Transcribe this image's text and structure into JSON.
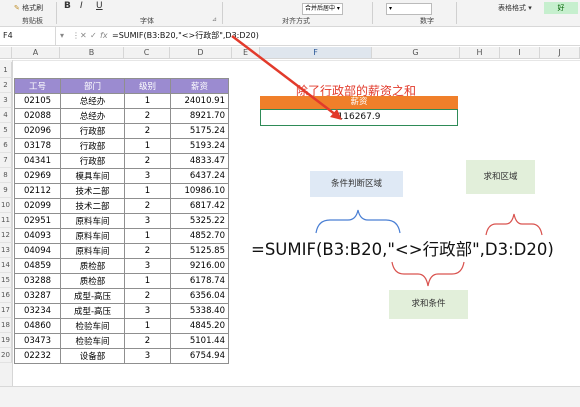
{
  "ribbon": {
    "format_painter": "格式刷",
    "groups": [
      "剪贴板",
      "字体",
      "对齐方式",
      "数字"
    ],
    "merge_label": "合并后居中",
    "table_style_label": "表格格式",
    "good_label": "好",
    "bold": "B",
    "italic": "I",
    "underline": "U"
  },
  "formula_bar": {
    "name_box": "F4",
    "fx": "fx",
    "formula": "=SUMIF(B3:B20,\"<>行政部\",D3:D20)"
  },
  "columns": [
    "A",
    "B",
    "C",
    "D",
    "E",
    "F",
    "G",
    "H",
    "I",
    "J"
  ],
  "rows": [
    "1",
    "2",
    "3",
    "4",
    "5",
    "6",
    "7",
    "8",
    "9",
    "10",
    "11",
    "12",
    "13",
    "14",
    "15",
    "16",
    "17",
    "18",
    "19",
    "20"
  ],
  "table": {
    "headers": [
      "工号",
      "部门",
      "级别",
      "薪资"
    ],
    "rows": [
      [
        "02105",
        "总经办",
        "1",
        "24010.91"
      ],
      [
        "02088",
        "总经办",
        "2",
        "8921.70"
      ],
      [
        "02096",
        "行政部",
        "2",
        "5175.24"
      ],
      [
        "03178",
        "行政部",
        "1",
        "5193.24"
      ],
      [
        "04341",
        "行政部",
        "2",
        "4833.47"
      ],
      [
        "02969",
        "模具车间",
        "3",
        "6437.24"
      ],
      [
        "02112",
        "技术二部",
        "1",
        "10986.10"
      ],
      [
        "02099",
        "技术二部",
        "2",
        "6817.42"
      ],
      [
        "02951",
        "原料车间",
        "3",
        "5325.22"
      ],
      [
        "04093",
        "原料车间",
        "1",
        "4852.70"
      ],
      [
        "04094",
        "原料车间",
        "2",
        "5125.85"
      ],
      [
        "04859",
        "质检部",
        "3",
        "9216.00"
      ],
      [
        "03288",
        "质检部",
        "1",
        "6178.74"
      ],
      [
        "03287",
        "成型-高压",
        "2",
        "6356.04"
      ],
      [
        "03234",
        "成型-高压",
        "3",
        "5338.40"
      ],
      [
        "04860",
        "检验车间",
        "1",
        "4845.20"
      ],
      [
        "03473",
        "检验车间",
        "2",
        "5101.44"
      ],
      [
        "02232",
        "设备部",
        "3",
        "6754.94"
      ]
    ]
  },
  "annotation": {
    "title": "除了行政部的薪资之和",
    "header": "薪资",
    "result": "116267.9",
    "criteria_range": "条件判断区域",
    "sum_range": "求和区域",
    "criteria": "求和条件",
    "big_formula": "=SUMIF(B3:B20,\"<>行政部\",D3:D20)"
  },
  "colors": {
    "table_header": "#9b8bd0",
    "orange": "#f07f2a",
    "red_text": "#e23a2b",
    "bracket_blue": "#4a7fd4",
    "bracket_red": "#d9534f"
  }
}
